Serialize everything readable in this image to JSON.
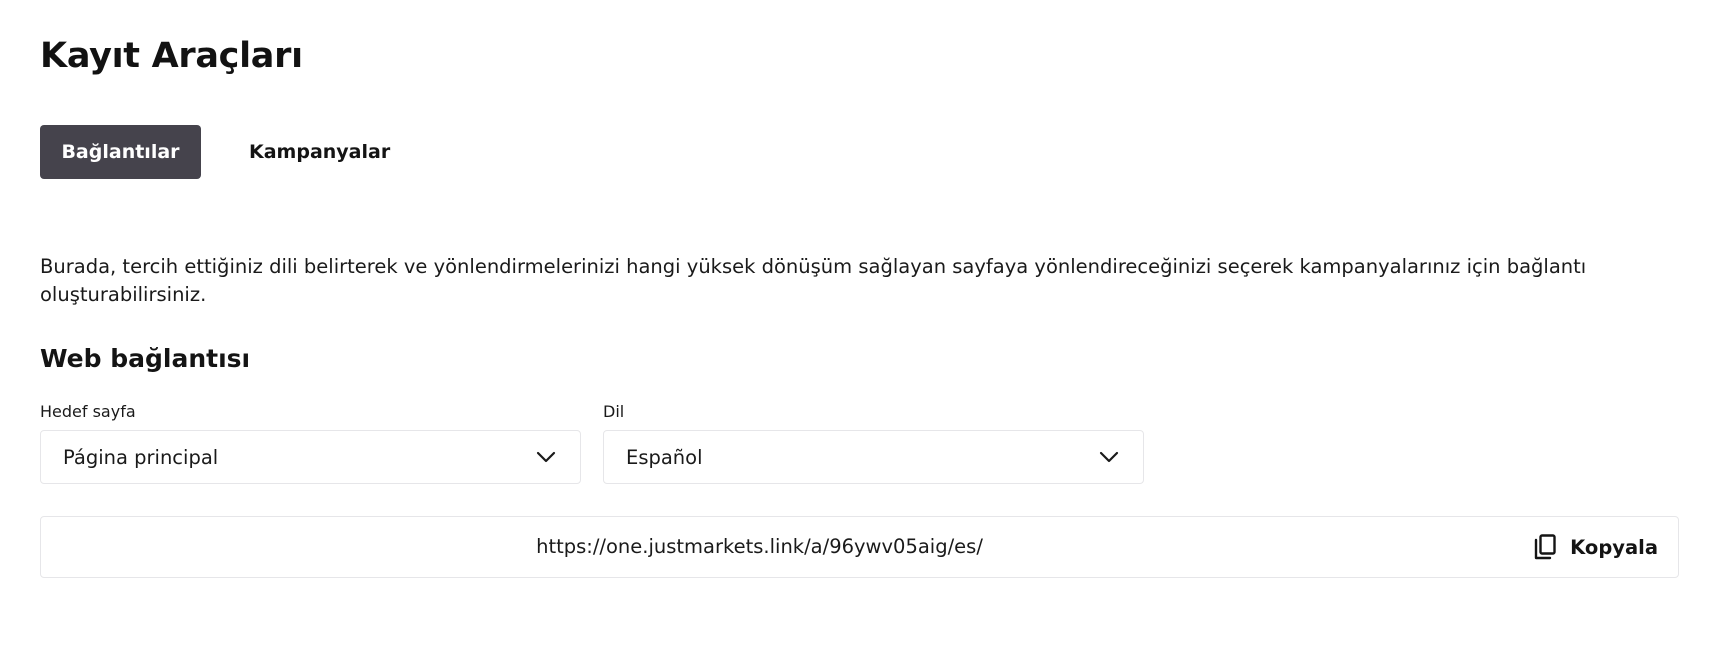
{
  "page": {
    "title": "Kayıt Araçları"
  },
  "tabs": [
    {
      "label": "Bağlantılar",
      "active": true
    },
    {
      "label": "Kampanyalar",
      "active": false
    }
  ],
  "description": "Burada, tercih ettiğiniz dili belirterek ve yönlendirmelerinizi hangi yüksek dönüşüm sağlayan sayfaya yönlendireceğinizi seçerek kampanyalarınız için bağlantı oluşturabilirsiniz.",
  "web_link": {
    "section_title": "Web bağlantısı",
    "target_page": {
      "label": "Hedef sayfa",
      "value": "Página principal"
    },
    "language": {
      "label": "Dil",
      "value": "Español"
    },
    "url": "https://one.justmarkets.link/a/96ywv05aig/es/",
    "copy_label": "Kopyala"
  },
  "icons": {
    "dropdown": "chevron-down-icon",
    "copy": "copy-icon"
  },
  "colors": {
    "active_tab_bg": "#45434c",
    "border": "#e6e6e9",
    "text": "#141414"
  }
}
